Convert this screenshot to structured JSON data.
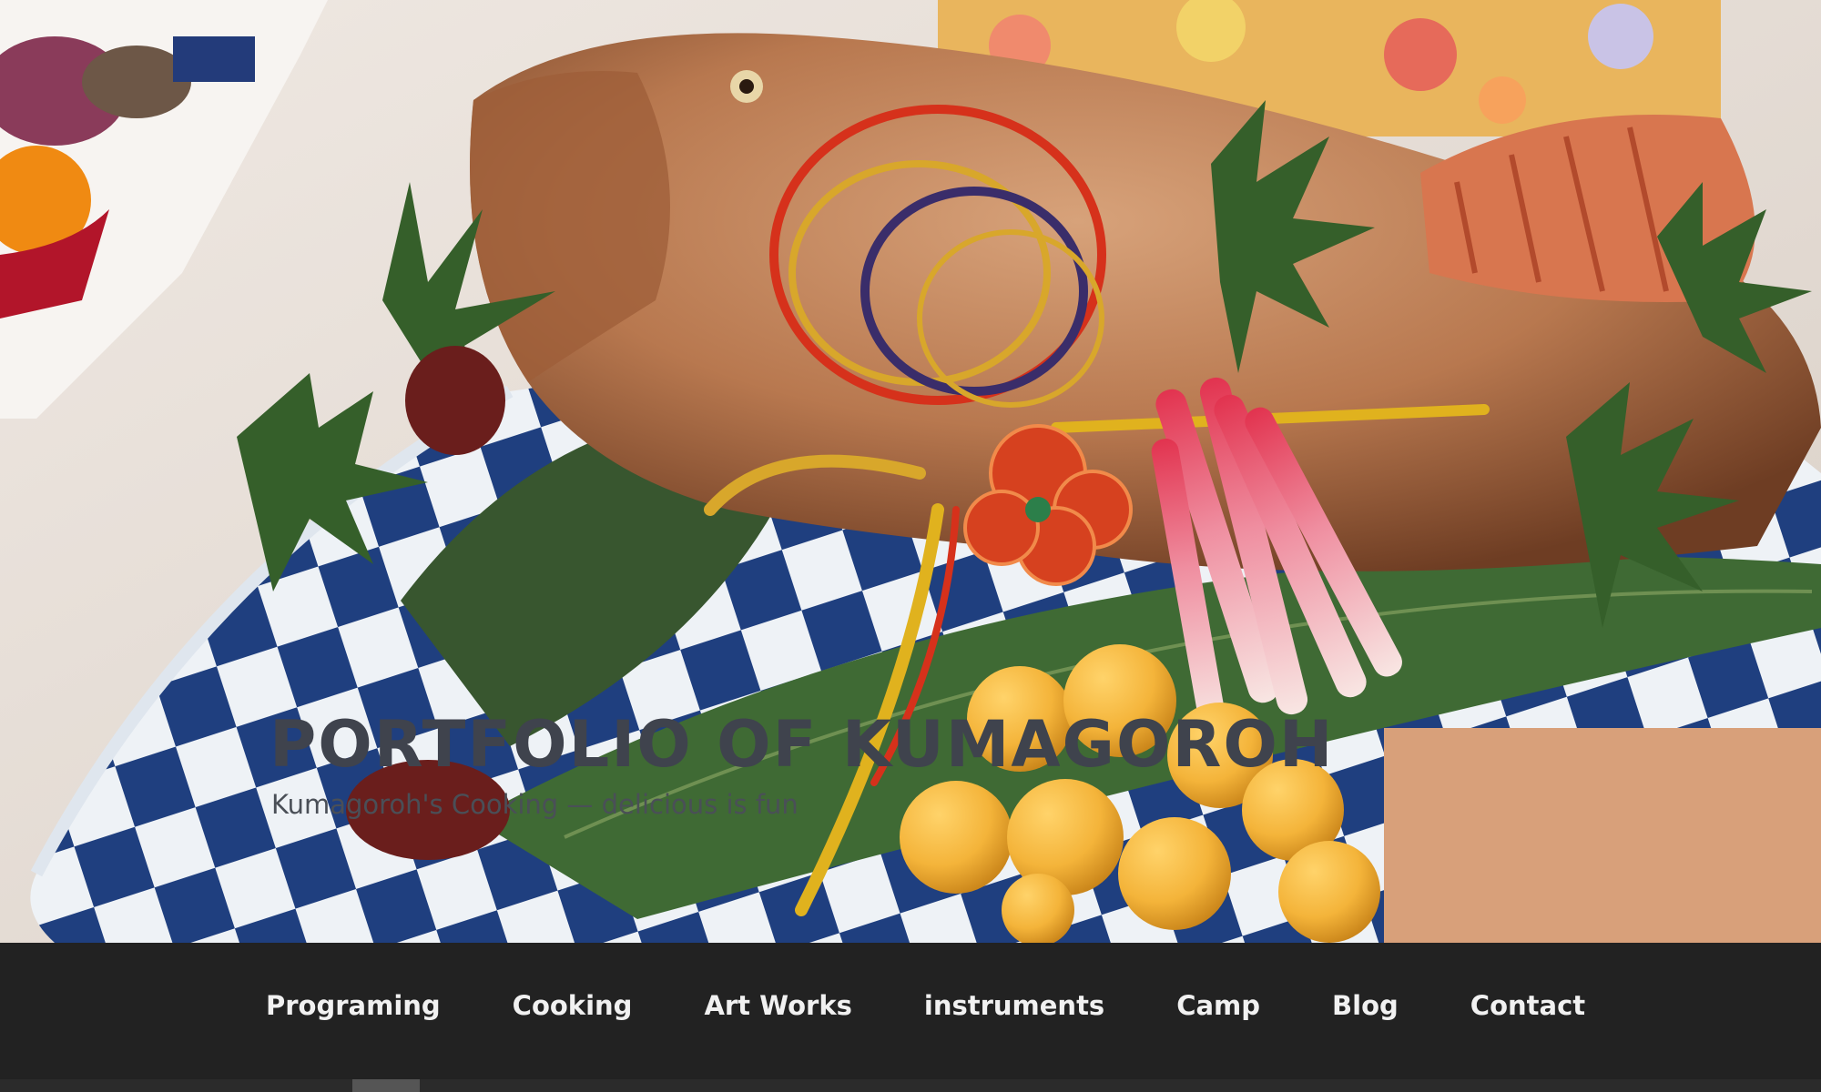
{
  "site": {
    "title": "PORTFOLIO OF KUMAGOROH",
    "description": "Kumagoroh's Cooking — delicious is fun"
  },
  "hero_image": {
    "subject": "grilled sea bream with mizuhiki knot on blue checkered plate",
    "colors": {
      "fish": "#b8784f",
      "leaf": "#3f6a34",
      "plate_blue": "#1f3f7f",
      "mizuhiki_red": "#d6311b",
      "gold": "#d8a72b"
    }
  },
  "navigation": {
    "items": [
      {
        "label": "Programing"
      },
      {
        "label": "Cooking"
      },
      {
        "label": "Art Works"
      },
      {
        "label": "instruments"
      },
      {
        "label": "Camp"
      },
      {
        "label": "Blog"
      },
      {
        "label": "Contact"
      }
    ]
  },
  "theme": {
    "nav_bg": "#222222",
    "nav_text": "#f1f1f1"
  }
}
